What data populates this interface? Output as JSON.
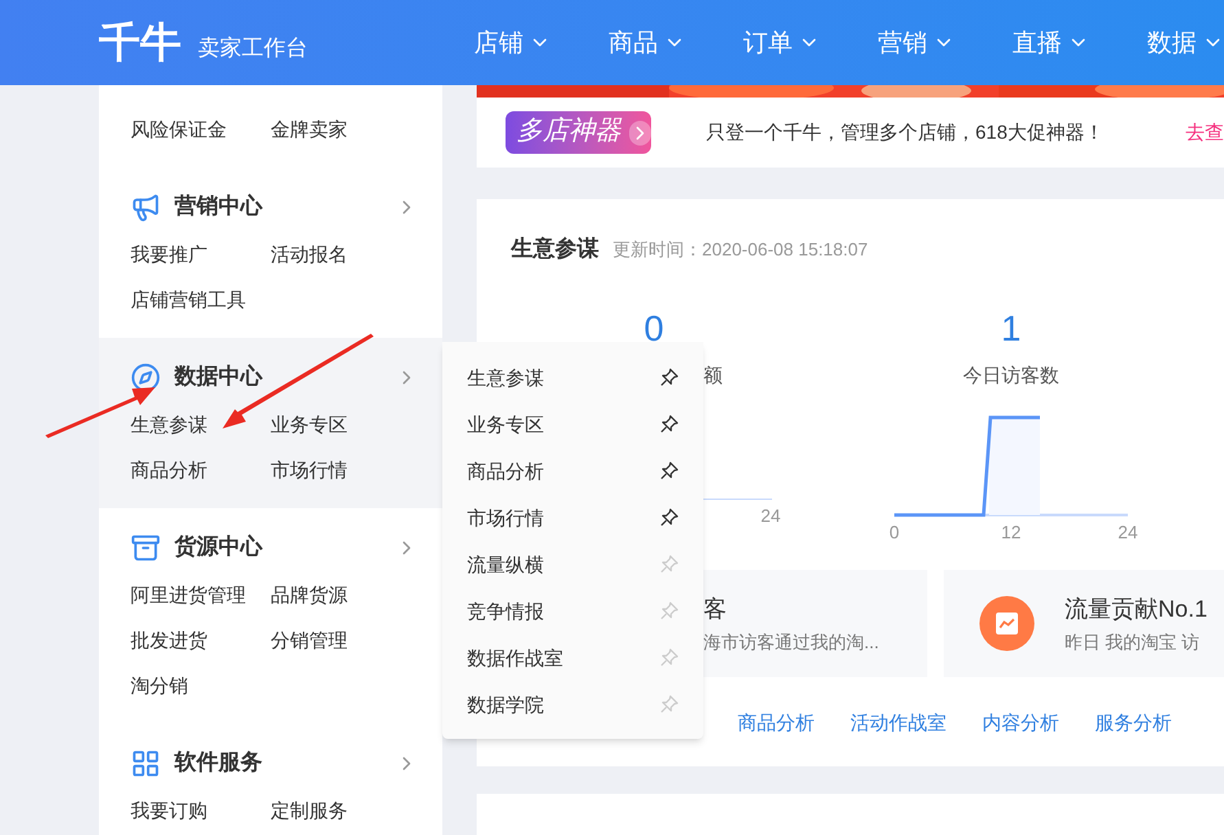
{
  "header": {
    "logo": "千牛",
    "subtitle": "卖家工作台",
    "nav": [
      "店铺",
      "商品",
      "订单",
      "营销",
      "直播",
      "数据"
    ]
  },
  "sidebar": {
    "top_row": [
      "风险保证金",
      "金牌卖家"
    ],
    "sections": [
      {
        "title": "营销中心",
        "selected": false,
        "items": [
          "我要推广",
          "活动报名",
          "店铺营销工具"
        ]
      },
      {
        "title": "数据中心",
        "selected": true,
        "items": [
          "生意参谋",
          "业务专区",
          "商品分析",
          "市场行情"
        ]
      },
      {
        "title": "货源中心",
        "selected": false,
        "items": [
          "阿里进货管理",
          "品牌货源",
          "批发进货",
          "分销管理",
          "淘分销"
        ]
      },
      {
        "title": "软件服务",
        "selected": false,
        "items": [
          "我要订购",
          "定制服务"
        ]
      }
    ]
  },
  "flyout": {
    "items": [
      {
        "label": "生意参谋",
        "pinned": true
      },
      {
        "label": "业务专区",
        "pinned": true
      },
      {
        "label": "商品分析",
        "pinned": true
      },
      {
        "label": "市场行情",
        "pinned": true
      },
      {
        "label": "流量纵横",
        "pinned": false
      },
      {
        "label": "竞争情报",
        "pinned": false
      },
      {
        "label": "数据作战室",
        "pinned": false
      },
      {
        "label": "数据学院",
        "pinned": false
      }
    ]
  },
  "promo": {
    "badge": "多店神器",
    "text": "只登一个千牛，管理多个店铺，618大促神器！",
    "link": "去查"
  },
  "overview": {
    "title": "生意参谋",
    "updated": "更新时间：2020-06-08 15:18:07",
    "metrics": [
      {
        "value": "0",
        "label": "额",
        "cut_off": true,
        "kind": "flat",
        "axis_labels": [
          "24"
        ]
      },
      {
        "value": "1",
        "label": "今日访客数",
        "cut_off": false,
        "kind": "step",
        "axis_labels": [
          "0",
          "12",
          "24"
        ]
      }
    ],
    "insights": [
      {
        "title": "客",
        "subtitle": "海市访客通过我的淘...",
        "cut_off": true
      },
      {
        "title": "流量贡献No.1",
        "subtitle": "昨日 我的淘宝 访",
        "cut_off": false
      }
    ],
    "links": [
      "商品分析",
      "活动作战室",
      "内容分析",
      "服务分析"
    ]
  }
}
